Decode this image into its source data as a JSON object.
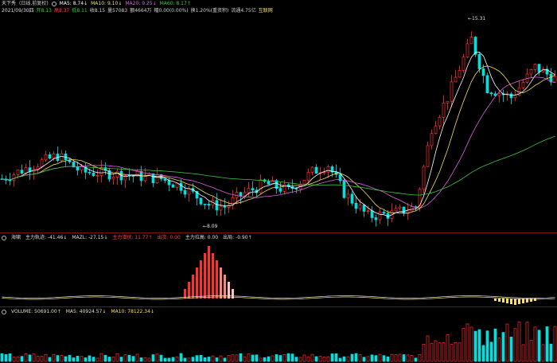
{
  "header": {
    "stock_name": "天下秀",
    "period": "日线",
    "adj": "前复权",
    "ma": [
      {
        "label": "MA5",
        "value": "8.74",
        "arrow": "↓",
        "color": "#ffffff"
      },
      {
        "label": "MA10",
        "value": "9.10",
        "arrow": "↓",
        "color": "#f5e062"
      },
      {
        "label": "MA20",
        "value": "9.25",
        "arrow": "↓",
        "color": "#e060e0"
      },
      {
        "label": "MA60",
        "value": "8.17",
        "arrow": "↑",
        "color": "#3fc63f"
      }
    ]
  },
  "info": {
    "date": "2021/09/30四",
    "items": [
      {
        "text": "开8.13",
        "color": "#3fc63f"
      },
      {
        "text": "高8.37",
        "color": "#ff4040"
      },
      {
        "text": "低8.11",
        "color": "#3fc63f"
      },
      {
        "text": "收8.15",
        "color": "#dddddd"
      },
      {
        "text": "量57083",
        "color": "#dddddd"
      },
      {
        "text": "额4664万",
        "color": "#dddddd"
      },
      {
        "text": "幅0.00(0.00%)",
        "color": "#dddddd"
      },
      {
        "text": "换1.20%(重资积)",
        "color": "#dddddd"
      },
      {
        "text": "流通4.75亿",
        "color": "#dddddd"
      },
      {
        "text": "互联网",
        "color": "#f5e062"
      }
    ]
  },
  "annotations": {
    "high": "15.31",
    "low": "8.09"
  },
  "indicator": {
    "name": "海啸",
    "items": [
      {
        "text": "主力轨迹: -41.46",
        "arrow": "↓",
        "color": "#dddddd"
      },
      {
        "text": "MAZL: -27.15",
        "arrow": "↓",
        "color": "#dddddd"
      },
      {
        "text": "主力潜伏: 11.77",
        "arrow": "↑",
        "color": "#ff4040"
      },
      {
        "text": "出货: 0.00",
        "arrow": "",
        "color": "#ff4040"
      },
      {
        "text": "主力拉高: 0.00",
        "arrow": "",
        "color": "#dddddd"
      },
      {
        "text": "出局: -0.90",
        "arrow": "↑",
        "color": "#dddddd"
      }
    ]
  },
  "volume": {
    "items": [
      {
        "text": "VOLUME: 50691.00",
        "arrow": "↑",
        "color": "#dddddd"
      },
      {
        "text": "MA5: 40924.57",
        "arrow": "↓",
        "color": "#dddddd"
      },
      {
        "text": "MA10: 78122.34",
        "arrow": "↓",
        "color": "#f5e062"
      }
    ]
  },
  "colors": {
    "up": "#ff3030",
    "down": "#00e0e0",
    "ma5": "#ffffff",
    "ma10": "#f5e062",
    "ma20": "#e060e0",
    "ma60": "#3fc63f"
  }
}
